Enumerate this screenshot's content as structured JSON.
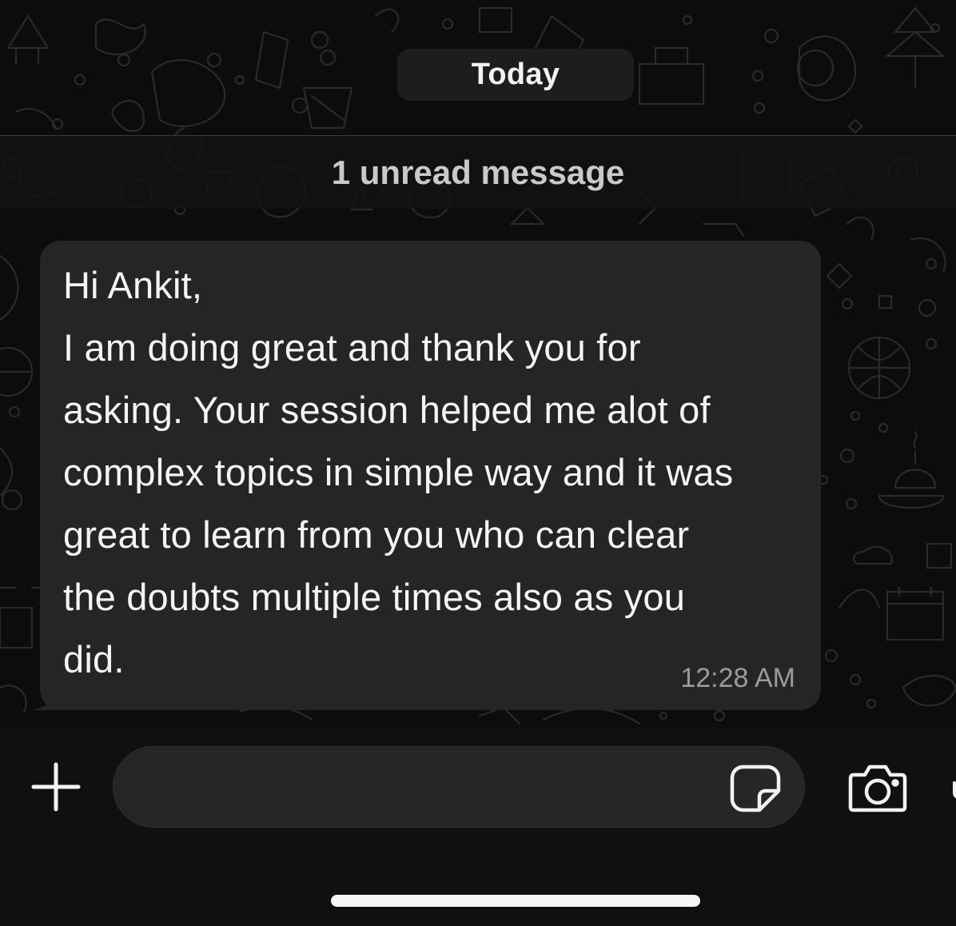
{
  "chat": {
    "date_label": "Today",
    "unread_label": "1 unread message"
  },
  "message": {
    "text": "Hi Ankit,\nI am doing great and thank you for\nasking. Your session helped me alot of\ncomplex topics in simple way and it was\ngreat to learn from you who can clear\nthe doubts multiple times also as you\ndid.",
    "time": "12:28 AM"
  },
  "composer": {
    "placeholder": "",
    "icons": [
      "plus-icon",
      "sticker-icon",
      "camera-icon",
      "microphone-icon"
    ]
  },
  "colors": {
    "background": "#0c0c0c",
    "bubble": "#242626",
    "unread_bar": "#121212",
    "text": "#f4f4f4",
    "time": "#9b9b9b"
  }
}
